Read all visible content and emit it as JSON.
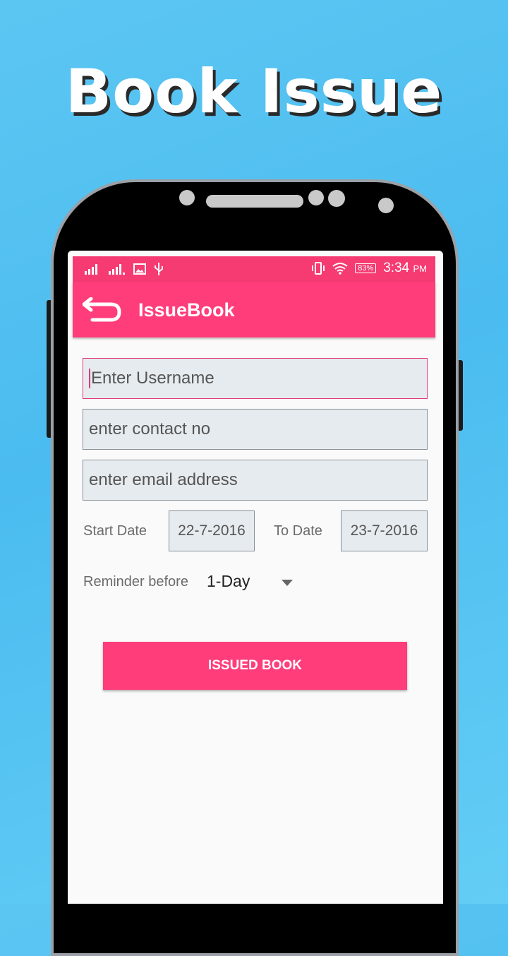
{
  "promo": {
    "title": "Book Issue"
  },
  "status_bar": {
    "battery": "83%",
    "time": "3:34",
    "ampm": "PM"
  },
  "appbar": {
    "title": "IssueBook",
    "back_icon": "back-arrow-icon"
  },
  "form": {
    "username_placeholder": "Enter Username",
    "contact_placeholder": "enter contact no",
    "email_placeholder": "enter email address",
    "start_date_label": "Start Date",
    "start_date_value": "22-7-2016",
    "to_date_label": "To Date",
    "to_date_value": "23-7-2016",
    "reminder_label": "Reminder before",
    "reminder_value": "1-Day",
    "submit_label": "ISSUED BOOK"
  },
  "colors": {
    "accent": "#ff3d7a",
    "status_bar": "#f53b72",
    "background": "#4bbcf0"
  }
}
